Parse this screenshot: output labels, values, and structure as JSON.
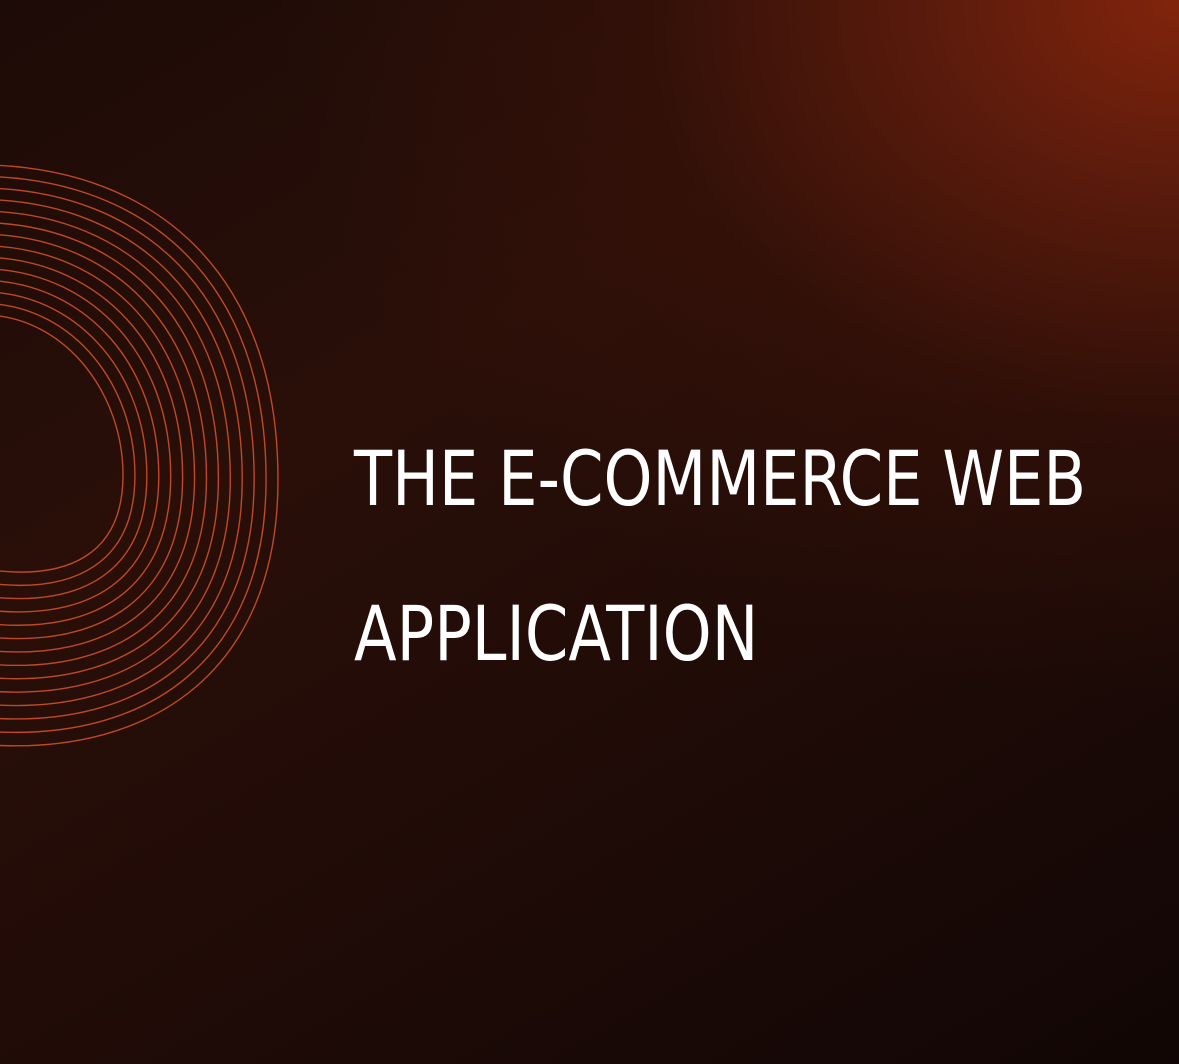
{
  "slide": {
    "title_line_1": "THE E-COMMERCE WEB",
    "title_line_2": "APPLICATION",
    "decoration": "wave-lines-graphic"
  },
  "colors": {
    "accent_line": "#d9532a",
    "text": "#ffffff",
    "background_dark": "#1a0906",
    "background_glow": "#82240c"
  }
}
